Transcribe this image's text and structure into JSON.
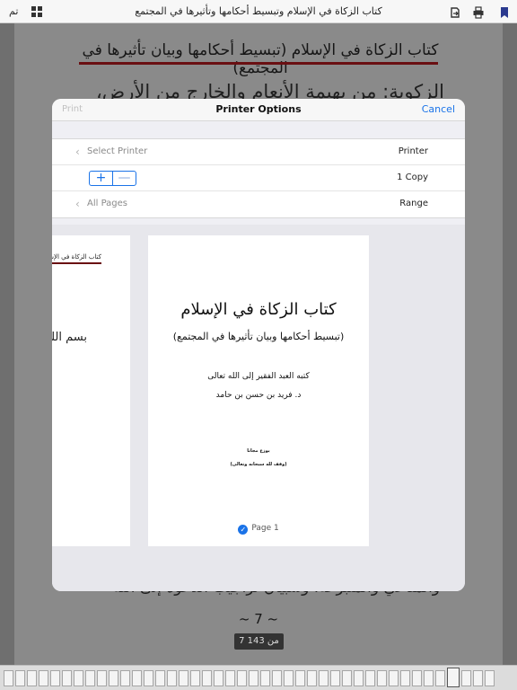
{
  "toolbar": {
    "done_label": "تم",
    "title": "كتاب الزكاة في الإسلام وتبسيط أحكامها وتأثيرها في المجتمع",
    "icons": [
      "grid-icon",
      "export-icon",
      "print-icon",
      "bookmark-icon"
    ],
    "bookmark_color": "#2b3a8f"
  },
  "document": {
    "heading": "كتاب الزكاة في الإسلام (تبسيط أحكامها وبيان تأثيرها في المجتمع)",
    "line_top": "الزكوية: من بهيمة الأنعام والخارج من الأرض،",
    "line_bottom": "والمتاعي والمتبرعة، وسبيان تراجيب الدعوة إلى الله",
    "page_number": "~ 7 ~",
    "page_indicator": "7 من 143",
    "accent": "#6a0f12"
  },
  "dialog": {
    "print_label": "Print",
    "title": "Printer Options",
    "cancel_label": "Cancel",
    "select_printer_label": "Select Printer",
    "printer_value": "Printer",
    "copies_plus": "+",
    "copies_minus": "—",
    "copies_value": "1 Copy",
    "pages_label": "All Pages",
    "range_value": "Range",
    "accent": "#1a73e8"
  },
  "preview": {
    "left_title": "كتاب الزكاة في الإسلام",
    "left_text": "بسم الله",
    "book_title": "كتاب الزكاة في الإسلام",
    "subtitle": "(تبسيط أحكامها وبيان تأثيرها في المجتمع)",
    "author_line1": "كتبه العبد الفقير إلى الله تعالى",
    "author_line2": "د. فريد بن حسن بن حامد",
    "footer1": "يوزع مجانا",
    "footer2": "(وقف لله سبحانه وتعالى)",
    "page_label": "Page 1",
    "check": "✓"
  }
}
